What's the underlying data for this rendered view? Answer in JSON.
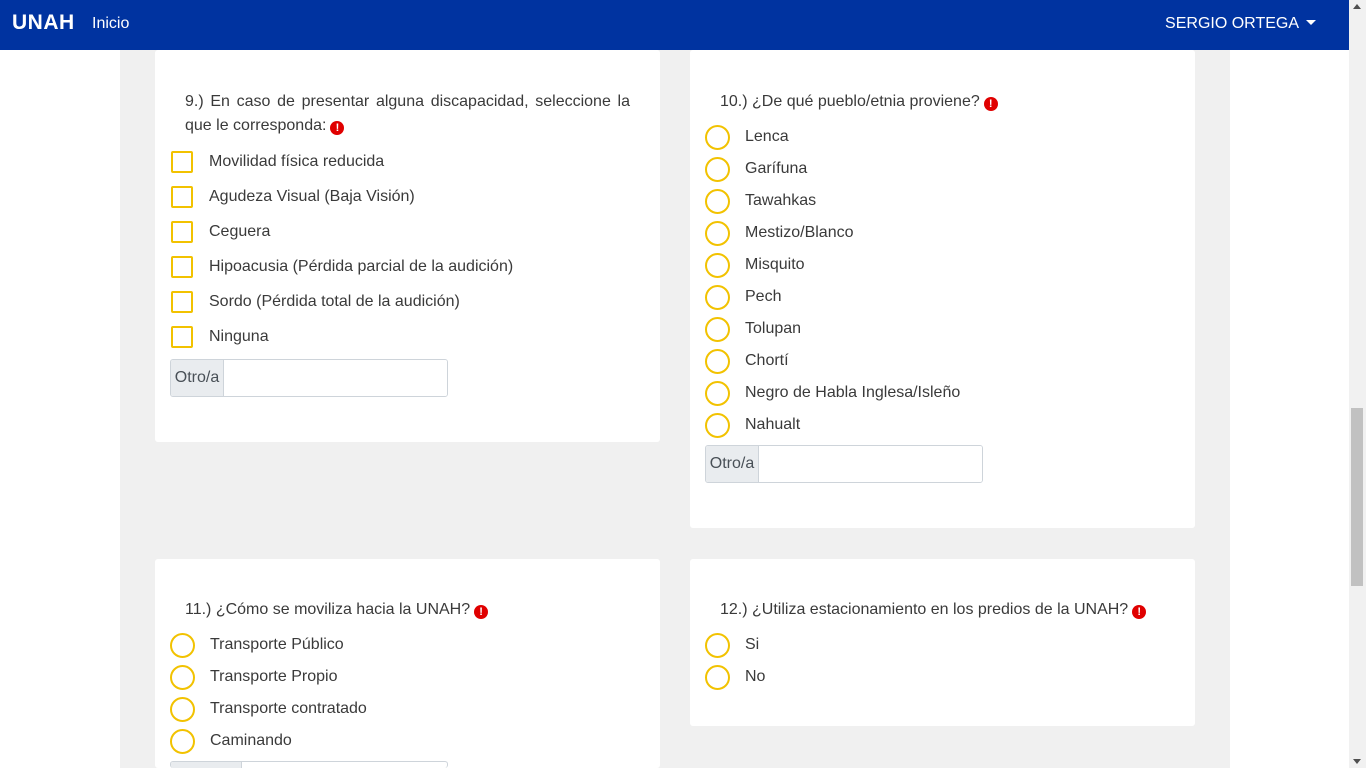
{
  "navbar": {
    "brand": "UNAH",
    "home_link": "Inicio",
    "user_name": "SERGIO ORTEGA"
  },
  "colors": {
    "navbar": "#0033a0",
    "accent": "#f2c200",
    "required": "#e00000"
  },
  "q9": {
    "title": "9.) En caso de presentar alguna discapacidad, seleccione la que le corresponda:",
    "options": [
      "Movilidad física reducida",
      "Agudeza Visual (Baja Visión)",
      "Ceguera",
      "Hipoacusia (Pérdida parcial de la audición)",
      "Sordo (Pérdida total de la audición)",
      "Ninguna"
    ],
    "other_label": "Otro/a"
  },
  "q10": {
    "title": "10.) ¿De qué pueblo/etnia proviene?",
    "options": [
      "Lenca",
      "Garífuna",
      "Tawahkas",
      "Mestizo/Blanco",
      "Misquito",
      "Pech",
      "Tolupan",
      "Chortí",
      "Negro de Habla Inglesa/Isleño",
      "Nahualt"
    ],
    "other_label": "Otro/a"
  },
  "q11": {
    "title": "11.) ¿Cómo se moviliza hacia la UNAH?",
    "options": [
      "Transporte Público",
      "Transporte Propio",
      "Transporte contratado",
      "Caminando"
    ]
  },
  "q12": {
    "title": "12.) ¿Utiliza estacionamiento en los predios de la UNAH?",
    "options": [
      "Si",
      "No"
    ]
  }
}
